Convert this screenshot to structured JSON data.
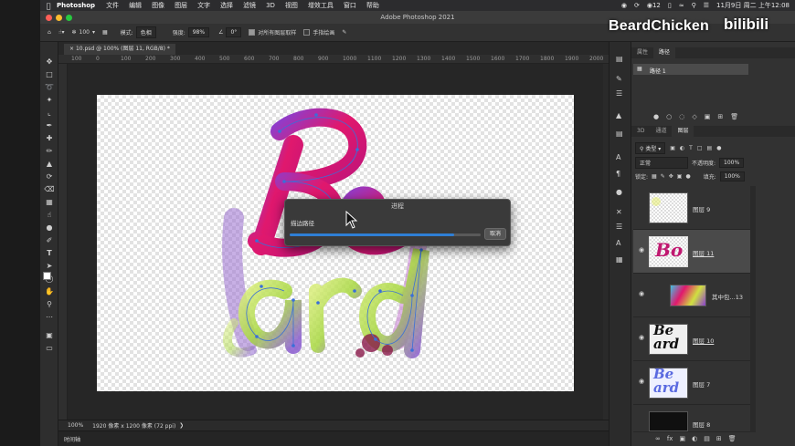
{
  "menubar": {
    "app_name": "Photoshop",
    "items": [
      "文件",
      "编辑",
      "图像",
      "图层",
      "文字",
      "选择",
      "滤镜",
      "3D",
      "视图",
      "增效工具",
      "窗口",
      "帮助"
    ],
    "status_count": "12",
    "datetime": "11月9日 周二 上午12:08"
  },
  "window": {
    "title": "Adobe Photoshop 2021"
  },
  "watermark": {
    "brand": "BeardChicken",
    "site": "bilibili"
  },
  "options_bar": {
    "brush_size": "100",
    "mode_label": "模式:",
    "mode_value": "色相",
    "strength_label": "强度:",
    "strength_value": "98%",
    "angle_value": "0°",
    "sample_all_label": "对所有图层取样",
    "finger_paint_label": "手指绘画"
  },
  "document": {
    "tab_title": "10.psd @ 100% (图层 11, RGB/8) *",
    "ruler_ticks": [
      "100",
      "0",
      "100",
      "200",
      "300",
      "400",
      "500",
      "600",
      "700",
      "800",
      "900",
      "1000",
      "1100",
      "1200",
      "1300",
      "1400",
      "1500",
      "1600",
      "1700",
      "1800",
      "1900",
      "2000"
    ]
  },
  "status_bar": {
    "zoom": "100%",
    "doc_info": "1920 像素 x 1200 像素 (72 ppi)"
  },
  "timeline": {
    "label": "时间轴"
  },
  "dialog": {
    "title": "进程",
    "label": "描边路径",
    "progress": 0.86,
    "cancel_label": "取消"
  },
  "paths_panel": {
    "tabs": [
      "属性",
      "路径"
    ],
    "path_name": "路径 1"
  },
  "layers_panel": {
    "tabs": [
      "3D",
      "通道",
      "图层"
    ],
    "filter_kind": "类型",
    "blend_mode": "正常",
    "opacity_label": "不透明度:",
    "opacity_value": "100%",
    "lock_label": "锁定:",
    "fill_label": "填充:",
    "fill_value": "100%",
    "layers": [
      {
        "name": "图层 9",
        "visible": false,
        "selected": false
      },
      {
        "name": "图层 11",
        "visible": true,
        "selected": true
      },
      {
        "name": "其中包...13",
        "visible": true,
        "selected": false
      },
      {
        "name": "图层 10",
        "visible": true,
        "selected": false
      },
      {
        "name": "图层 7",
        "visible": true,
        "selected": false
      },
      {
        "name": "图层 8",
        "visible": false,
        "selected": false
      }
    ]
  },
  "colors": {
    "accent": "#2f7fd6",
    "brush_pink": "#e0186d",
    "brush_green": "#b5e04a",
    "path_blue": "#3a6fd8"
  }
}
